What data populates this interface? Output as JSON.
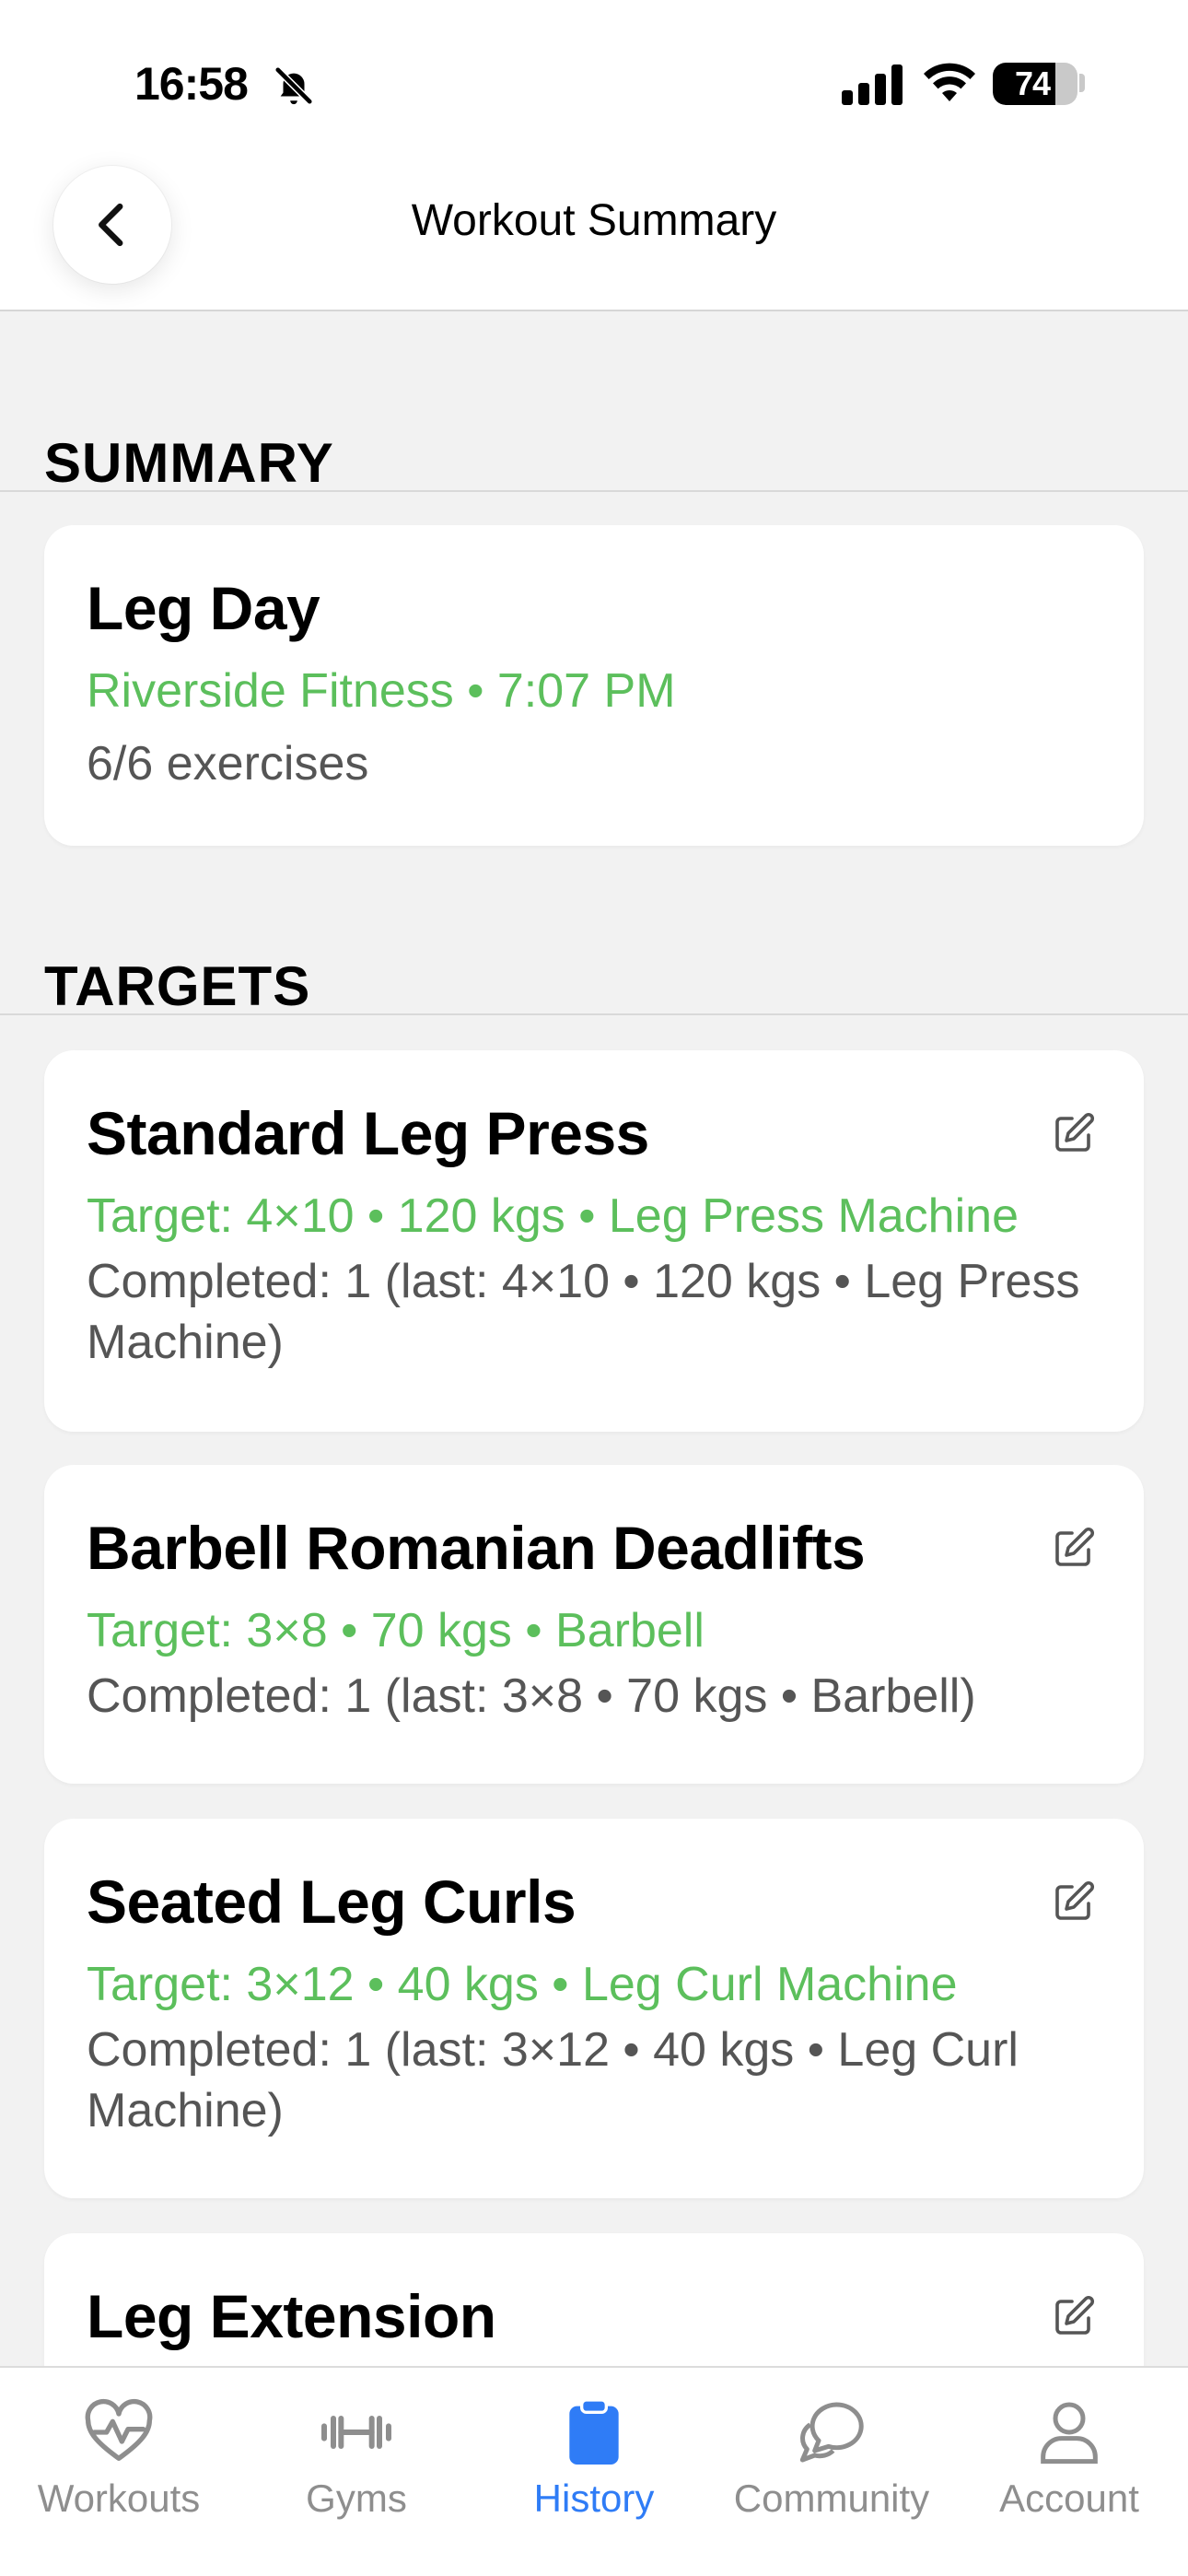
{
  "status_bar": {
    "time": "16:58",
    "battery_level": "74",
    "battery_percent": 74,
    "icons": [
      "bell-slash-icon",
      "signal-icon",
      "wifi-icon",
      "battery-icon"
    ]
  },
  "header": {
    "title": "Workout Summary",
    "back_icon": "chevron-left-icon"
  },
  "sections": {
    "summary_title": "SUMMARY",
    "targets_title": "TARGETS"
  },
  "summary": {
    "name": "Leg Day",
    "location_time": "Riverside Fitness • 7:07 PM",
    "exercise_count": "6/6 exercises"
  },
  "targets": [
    {
      "name": "Standard Leg Press",
      "target": "Target: 4×10 • 120 kgs • Leg Press Machine",
      "completed": "Completed: 1 (last: 4×10 • 120 kgs • Leg Press Machine)"
    },
    {
      "name": "Barbell Romanian Deadlifts",
      "target": "Target: 3×8 • 70 kgs • Barbell",
      "completed": "Completed: 1 (last: 3×8 • 70 kgs • Barbell)"
    },
    {
      "name": "Seated Leg Curls",
      "target": "Target: 3×12 • 40 kgs • Leg Curl Machine",
      "completed": "Completed: 1 (last: 3×12 • 40 kgs • Leg Curl Machine)"
    },
    {
      "name": "Leg Extension"
    }
  ],
  "tabbar": {
    "active": "History",
    "items": [
      {
        "label": "Workouts",
        "icon": "heart-pulse-icon"
      },
      {
        "label": "Gyms",
        "icon": "dumbbell-icon"
      },
      {
        "label": "History",
        "icon": "clipboard-icon"
      },
      {
        "label": "Community",
        "icon": "chat-bubbles-icon"
      },
      {
        "label": "Account",
        "icon": "person-icon"
      }
    ]
  },
  "colors": {
    "accent_green": "#5cbf5c",
    "active_blue": "#2f7cf6",
    "inactive_gray": "#8e8e8e"
  }
}
